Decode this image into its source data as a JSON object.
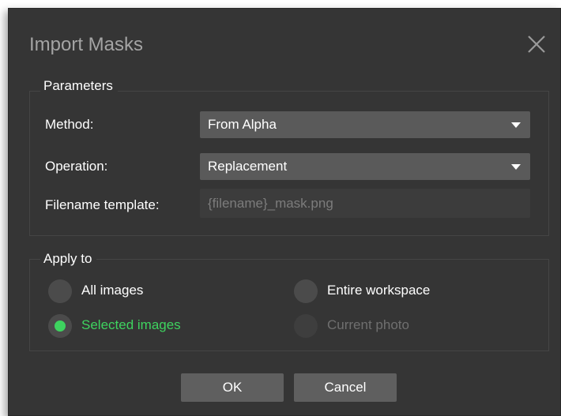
{
  "dialog": {
    "title": "Import Masks",
    "close_icon": "close-icon"
  },
  "parameters": {
    "label": "Parameters",
    "method": {
      "label": "Method:",
      "value": "From Alpha"
    },
    "operation": {
      "label": "Operation:",
      "value": "Replacement"
    },
    "filename_template": {
      "label": "Filename template:",
      "placeholder": "{filename}_mask.png"
    }
  },
  "apply_to": {
    "label": "Apply to",
    "options": {
      "all_images": {
        "label": "All images",
        "selected": false,
        "enabled": true
      },
      "entire_workspace": {
        "label": "Entire workspace",
        "selected": false,
        "enabled": true
      },
      "selected_images": {
        "label": "Selected images",
        "selected": true,
        "enabled": true
      },
      "current_photo": {
        "label": "Current photo",
        "selected": false,
        "enabled": false
      }
    }
  },
  "buttons": {
    "ok": "OK",
    "cancel": "Cancel"
  },
  "colors": {
    "dialog_bg": "#353535",
    "accent_green": "#3ed35f",
    "control_bg": "#5a5a5a"
  }
}
